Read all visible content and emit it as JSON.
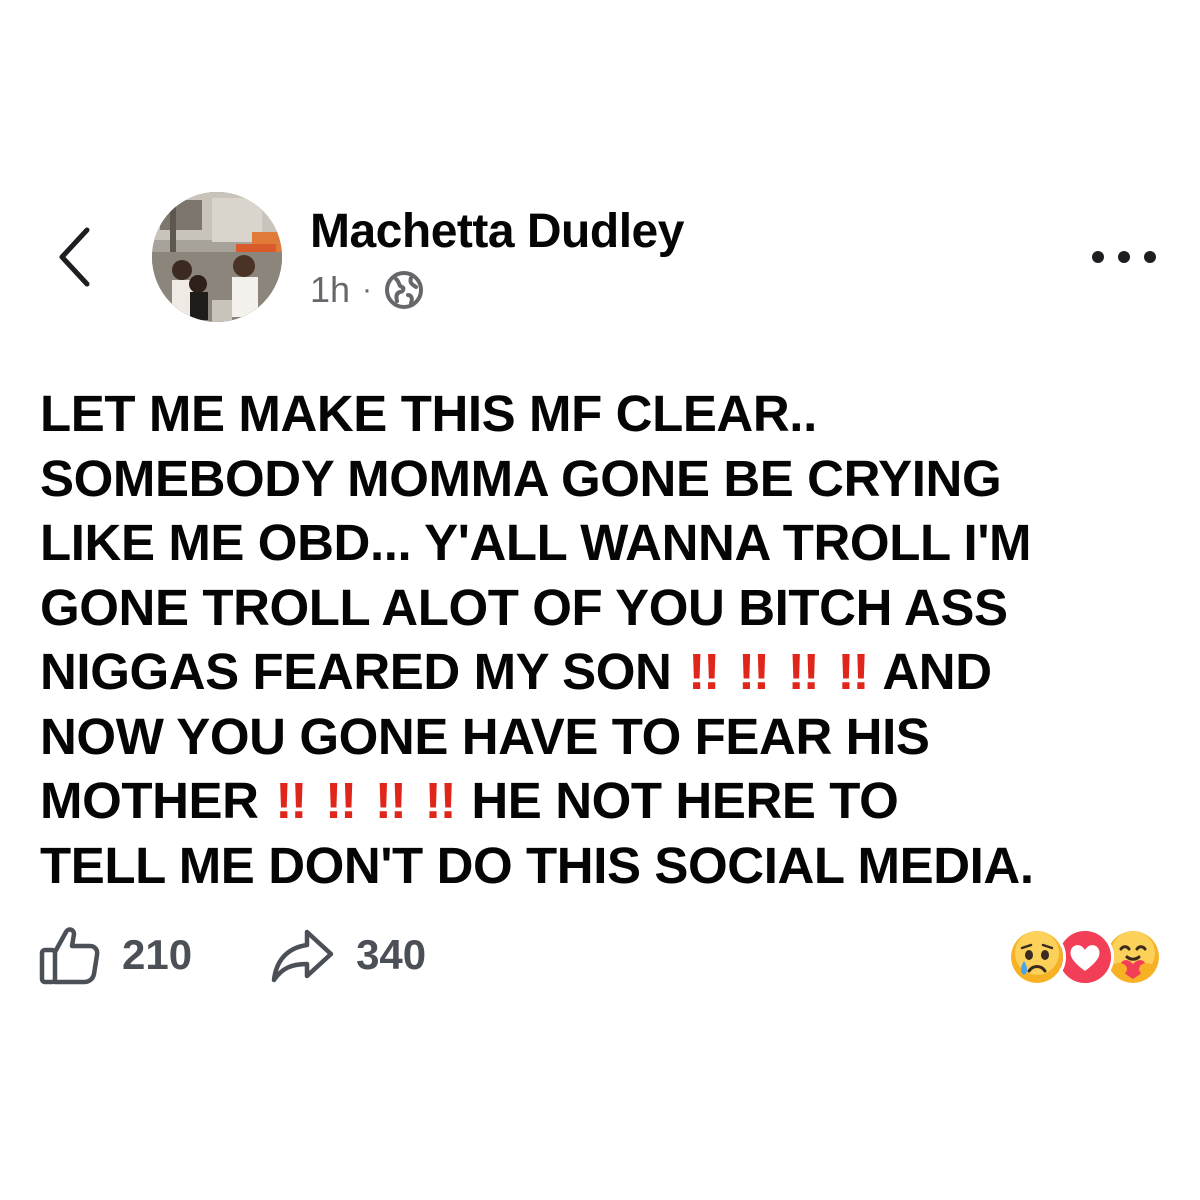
{
  "post": {
    "author": "Machetta Dudley",
    "time": "1h",
    "separator": "·",
    "privacy_icon": "globe-icon",
    "body_lines": [
      [
        "LET ME MAKE THIS MF CLEAR.."
      ],
      [
        "SOMEBODY MOMMA GONE BE CRYING"
      ],
      [
        "LIKE ME OBD... Y'ALL WANNA TROLL I'M"
      ],
      [
        "GONE TROLL ALOT OF YOU BITCH ASS"
      ],
      [
        "NIGGAS FEARED MY SON",
        "!!",
        "!!",
        "!!",
        "!!",
        "AND"
      ],
      [
        "NOW YOU GONE HAVE TO FEAR HIS"
      ],
      [
        "MOTHER",
        "!!",
        "!!",
        "!!",
        "!!",
        "HE NOT HERE TO"
      ],
      [
        "TELL ME DON'T DO THIS SOCIAL MEDIA."
      ]
    ],
    "emphasis_color": "#e0261b"
  },
  "header": {
    "back_icon": "chevron-left-icon",
    "more_icon": "more-options-icon"
  },
  "actions": {
    "like_count": "210",
    "like_icon": "thumbs-up-icon",
    "share_count": "340",
    "share_icon": "share-arrow-icon"
  },
  "reactions": [
    "sad-emoji-icon",
    "love-heart-icon",
    "care-hug-emoji-icon"
  ],
  "colors": {
    "text": "#050505",
    "secondary_text": "#65676b",
    "action_gray": "#4b4f56",
    "love": "#f33e58",
    "sad_yellow": "#f7b125"
  }
}
